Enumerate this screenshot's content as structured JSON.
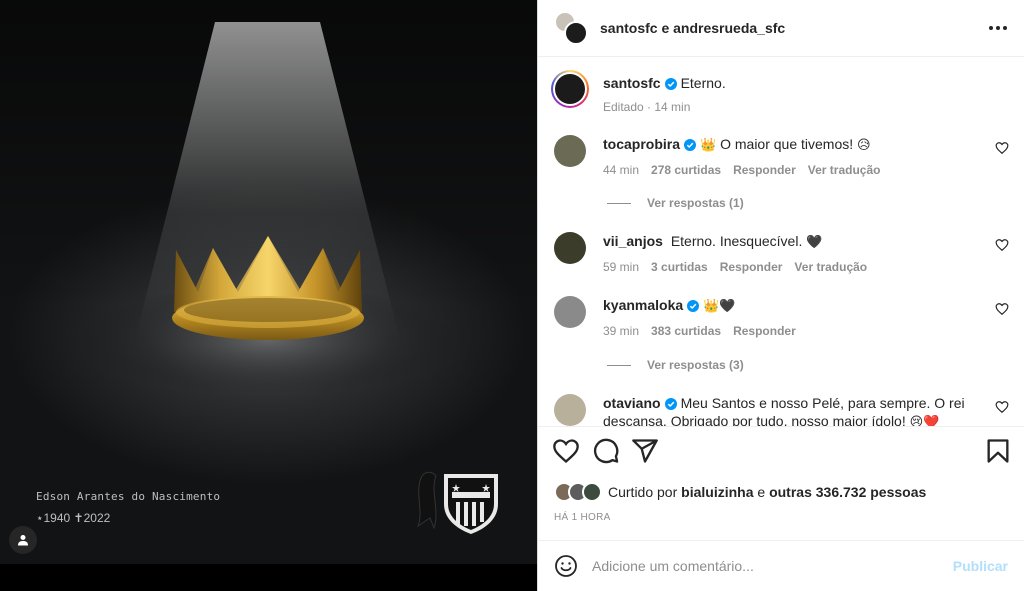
{
  "media": {
    "line1": "Edson Arantes do Nascimento",
    "line2": "⋆1940 ✝2022",
    "tag_button_icon": "user-icon",
    "crown_color": "#c9a233"
  },
  "header": {
    "title": "santosfc e andresrueda_sfc",
    "more_icon": "more-horizontal-icon"
  },
  "caption": {
    "username": "santosfc",
    "text": "Eterno.",
    "meta": "Editado · 14 min"
  },
  "comments": [
    {
      "username": "tocaprobira",
      "verified": true,
      "text": "O maior que tivemos!",
      "emoji_before": "👑",
      "emoji_after": "😥",
      "time": "44 min",
      "likes": "278 curtidas",
      "reply": "Responder",
      "translate": "Ver tradução",
      "avatar_color": "#6b6a55"
    },
    {
      "username": "vii_anjos",
      "verified": false,
      "text": "Eterno. Inesquecível.",
      "emoji_after": "🖤",
      "time": "59 min",
      "likes": "3 curtidas",
      "reply": "Responder",
      "translate": "Ver tradução",
      "avatar_color": "#3b3d2a"
    },
    {
      "username": "kyanmaloka",
      "verified": true,
      "text": "",
      "emoji_after": "👑🖤",
      "time": "39 min",
      "likes": "383 curtidas",
      "reply": "Responder",
      "avatar_color": "#8a8a8a"
    },
    {
      "username": "otaviano",
      "verified": true,
      "text": "Meu Santos e nosso Pelé, para sempre. O rei descansa. Obrigado por tudo, nosso maior ídolo!",
      "emoji_after": "😢❤️",
      "avatar_color": "#b9b09c"
    }
  ],
  "replies": [
    {
      "label": "Ver respostas (1)"
    },
    {
      "label": "Ver respostas (3)"
    }
  ],
  "likes": {
    "prefix": "Curtido por",
    "user": "bialuizinha",
    "middle": "e",
    "others": "outras 336.732 pessoas"
  },
  "time_ago": "HÁ 1 HORA",
  "comment_box": {
    "placeholder": "Adicione um comentário...",
    "publish": "Publicar"
  },
  "colors": {
    "verified": "#0095f6",
    "publish_disabled": "#b2dffc",
    "muted": "#8e8e8e"
  }
}
